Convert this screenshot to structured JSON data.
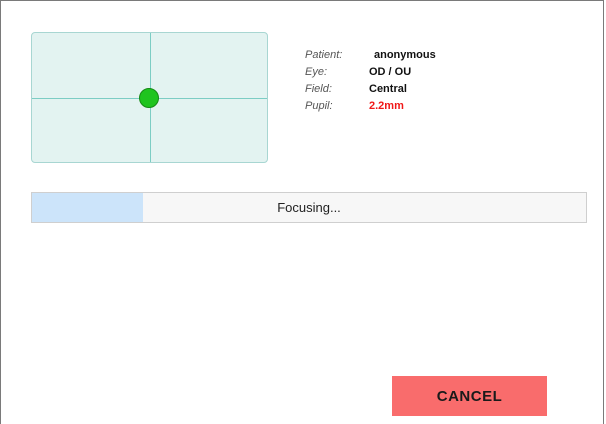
{
  "patient_info": {
    "patient": {
      "label": "Patient:",
      "value": "anonymous"
    },
    "eye": {
      "label": "Eye:",
      "value": "OD / OU"
    },
    "field": {
      "label": "Field:",
      "value": "Central"
    },
    "pupil": {
      "label": "Pupil:",
      "value": "2.2mm"
    }
  },
  "progress": {
    "status_text": "Focusing...",
    "fraction": 0.2
  },
  "actions": {
    "cancel_label": "CANCEL"
  },
  "colors": {
    "alert_red": "#f01818",
    "progress_fill": "#cce4fa",
    "cancel_button": "#f96c6c",
    "target_green": "#1fc41f",
    "view_background": "#e3f3f1"
  }
}
